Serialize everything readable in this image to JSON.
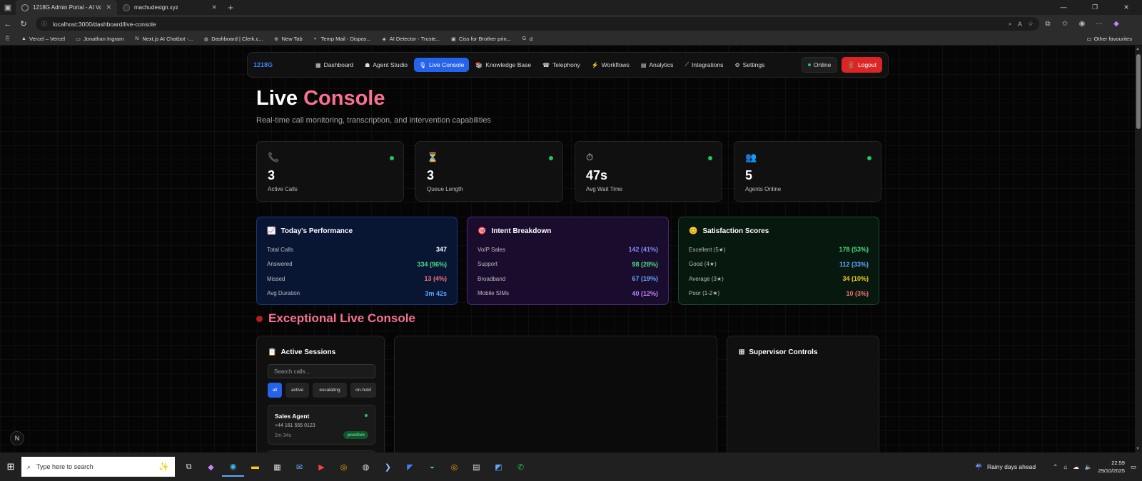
{
  "browser": {
    "tabs": [
      {
        "title": "1218G Admin Portal - AI Voice Ag",
        "active": true
      },
      {
        "title": "machudesign.xyz",
        "active": false
      }
    ],
    "url": "localhost:3000/dashboard/live-console",
    "bookmarks": [
      "Vercel – Vercel",
      "Jonathan Ingram",
      "Next.js AI Chatbot -...",
      "Dashboard | Clerk.c...",
      "New Tab",
      "Temp Mail - Dispos...",
      "AI Detector - Truste...",
      "Ciss for Brother prin...",
      "d"
    ],
    "other_favourites": "Other favourites"
  },
  "nav": {
    "brand": "1218G",
    "items": [
      {
        "icon": "▦",
        "label": "Dashboard"
      },
      {
        "icon": "☗",
        "label": "Agent Studio"
      },
      {
        "icon": "🎙",
        "label": "Live Console"
      },
      {
        "icon": "📚",
        "label": "Knowledge Base"
      },
      {
        "icon": "☎",
        "label": "Telephony"
      },
      {
        "icon": "⚡",
        "label": "Workflows"
      },
      {
        "icon": "▤",
        "label": "Analytics"
      },
      {
        "icon": "⟋",
        "label": "Integrations"
      },
      {
        "icon": "⚙",
        "label": "Settings"
      }
    ],
    "active_index": 2,
    "status": "Online",
    "logout": "Logout"
  },
  "header": {
    "title_main": "Live",
    "title_accent": "Console",
    "subtitle": "Real-time call monitoring, transcription, and intervention capabilities"
  },
  "stats": [
    {
      "icon": "phone-icon",
      "glyph": "📞",
      "value": "3",
      "label": "Active Calls"
    },
    {
      "icon": "hourglass-icon",
      "glyph": "⏳",
      "value": "3",
      "label": "Queue Length"
    },
    {
      "icon": "stopwatch-icon",
      "glyph": "⏱",
      "value": "47s",
      "label": "Avg Wait Time"
    },
    {
      "icon": "agents-icon",
      "glyph": "👥",
      "value": "5",
      "label": "Agents Online"
    }
  ],
  "performance": {
    "title": "Today's Performance",
    "rows": [
      {
        "label": "Total Calls",
        "value": "347",
        "color": "#ffffff"
      },
      {
        "label": "Answered",
        "value": "334 (96%)",
        "color": "#4ade80"
      },
      {
        "label": "Missed",
        "value": "13 (4%)",
        "color": "#f87171"
      },
      {
        "label": "Avg Duration",
        "value": "3m 42s",
        "color": "#60a5fa"
      }
    ]
  },
  "intent": {
    "title": "Intent Breakdown",
    "rows": [
      {
        "label": "VoIP Sales",
        "value": "142 (41%)",
        "color": "#818cf8"
      },
      {
        "label": "Support",
        "value": "98 (28%)",
        "color": "#4ade80"
      },
      {
        "label": "Broadband",
        "value": "67 (19%)",
        "color": "#60a5fa"
      },
      {
        "label": "Mobile SIMs",
        "value": "40 (12%)",
        "color": "#c084fc"
      }
    ]
  },
  "satisfaction": {
    "title": "Satisfaction Scores",
    "rows": [
      {
        "label": "Excellent (5★)",
        "value": "178 (53%)",
        "color": "#4ade80"
      },
      {
        "label": "Good (4★)",
        "value": "112 (33%)",
        "color": "#60a5fa"
      },
      {
        "label": "Average (3★)",
        "value": "34 (10%)",
        "color": "#facc15"
      },
      {
        "label": "Poor (1-2★)",
        "value": "10 (3%)",
        "color": "#f87171"
      }
    ]
  },
  "section_title": "Exceptional Live Console",
  "sessions": {
    "title": "Active Sessions",
    "search_placeholder": "Search calls...",
    "filters": [
      "all",
      "active",
      "escalating",
      "on-hold"
    ],
    "items": [
      {
        "name": "Sales Agent",
        "phone": "+44 161 555 0123",
        "duration": "2m 34s",
        "sentiment": "positive"
      }
    ]
  },
  "supervisor": {
    "title": "Supervisor Controls"
  },
  "taskbar": {
    "search_placeholder": "Type here to search",
    "weather": "Rainy days ahead",
    "time": "22:59",
    "date": "29/10/2025"
  }
}
